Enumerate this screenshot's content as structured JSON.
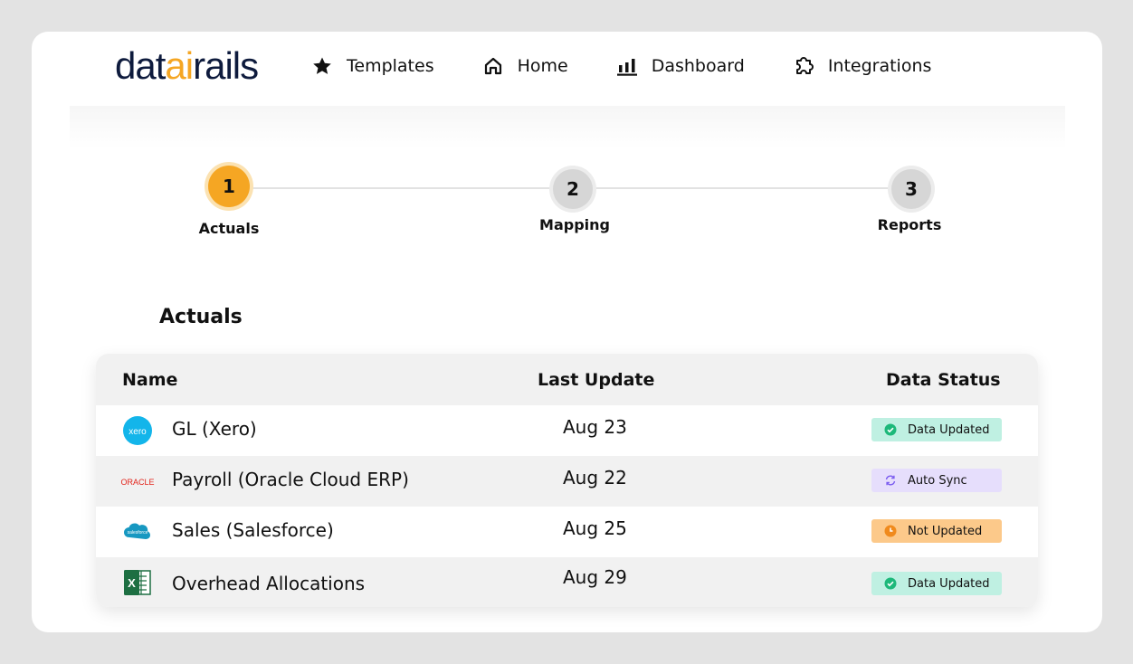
{
  "header": {
    "logo_pre": "dat",
    "logo_mid": "ai",
    "logo_post": "rails",
    "nav": [
      {
        "label": "Templates",
        "icon": "star-icon"
      },
      {
        "label": "Home",
        "icon": "home-icon"
      },
      {
        "label": "Dashboard",
        "icon": "bar-chart-icon"
      },
      {
        "label": "Integrations",
        "icon": "puzzle-icon"
      }
    ]
  },
  "stepper": {
    "steps": [
      {
        "number": "1",
        "label": "Actuals",
        "state": "active"
      },
      {
        "number": "2",
        "label": "Mapping",
        "state": "idle"
      },
      {
        "number": "3",
        "label": "Reports",
        "state": "idle"
      }
    ]
  },
  "section": {
    "title": "Actuals"
  },
  "table": {
    "headers": {
      "name": "Name",
      "last_update": "Last Update",
      "data_status": "Data Status"
    },
    "rows": [
      {
        "icon": "xero-logo-icon",
        "name": "GL (Xero)",
        "date": "Aug 23",
        "status": "Data Updated",
        "status_type": "updated"
      },
      {
        "icon": "oracle-logo-icon",
        "name": "Payroll (Oracle Cloud ERP)",
        "date": "Aug 22",
        "status": "Auto Sync",
        "status_type": "sync"
      },
      {
        "icon": "salesforce-logo-icon",
        "name": "Sales (Salesforce)",
        "date": "Aug 25",
        "status": "Not Updated",
        "status_type": "notup"
      },
      {
        "icon": "excel-logo-icon",
        "name": "Overhead Allocations",
        "date": "Aug 29",
        "status": "Data Updated",
        "status_type": "updated"
      }
    ],
    "logo_text": {
      "xero": "xero",
      "oracle": "ORACLE",
      "salesforce": "salesforce",
      "excel": "X"
    }
  },
  "colors": {
    "accent": "#f5a623",
    "updated": "#bff0e2",
    "sync": "#e6defc",
    "not_updated": "#fcc98a"
  }
}
